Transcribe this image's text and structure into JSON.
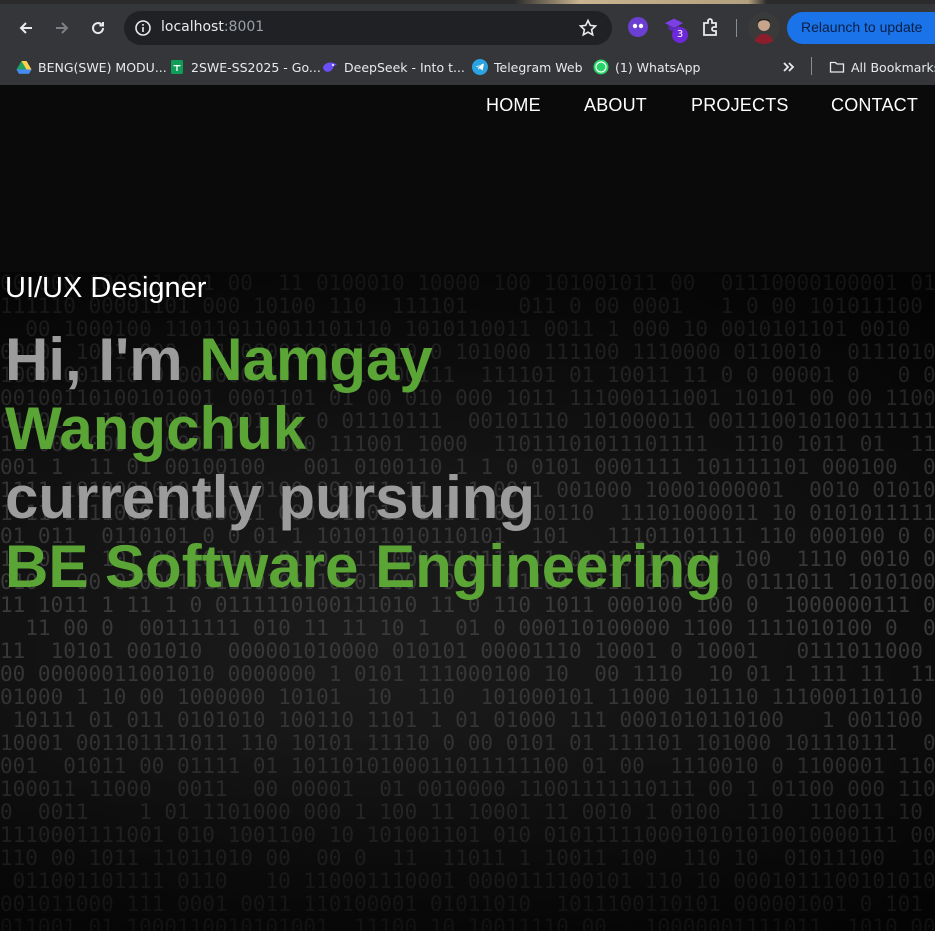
{
  "browser": {
    "url_host": "localhost",
    "url_port": ":8001",
    "extension_badge": "3",
    "relaunch_label": "Relaunch to update",
    "bookmarks": [
      {
        "label": "BENG(SWE) MODU...",
        "icon": "google-drive-icon"
      },
      {
        "label": "2SWE-SS2025 - Go...",
        "icon": "google-sheets-icon"
      },
      {
        "label": "DeepSeek - Into t...",
        "icon": "deepseek-icon"
      },
      {
        "label": "Telegram Web",
        "icon": "telegram-icon"
      },
      {
        "label": "(1) WhatsApp",
        "icon": "whatsapp-icon"
      }
    ],
    "all_bookmarks_label": "All Bookmarks"
  },
  "nav": {
    "home": "HOME",
    "about": "ABOUT",
    "projects": "PROJECTS",
    "contact": "CONTACT"
  },
  "hero": {
    "role": "UI/UX Designer",
    "greeting": "Hi, I'm ",
    "first_name": "Namgay",
    "last_name": "Wangchuk",
    "pursuing": "currently pursuing",
    "degree": "BE Software Engineering"
  },
  "colors": {
    "accent_green": "#5aa535",
    "grey_text": "#9c9c9c",
    "background": "#0a0a0a"
  }
}
